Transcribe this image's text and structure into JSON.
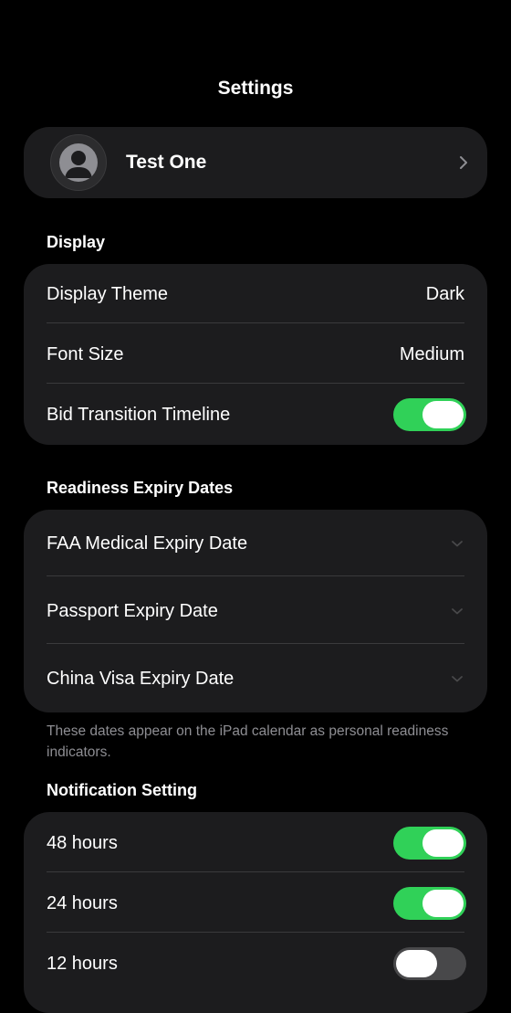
{
  "header": {
    "title": "Settings"
  },
  "profile": {
    "name": "Test One",
    "avatar_icon": "person-icon",
    "chevron_icon": "chevron-right-icon"
  },
  "display": {
    "header": "Display",
    "theme_label": "Display Theme",
    "theme_value": "Dark",
    "font_label": "Font Size",
    "font_value": "Medium",
    "bid_label": "Bid Transition Timeline",
    "bid_enabled": true
  },
  "readiness": {
    "header": "Readiness Expiry Dates",
    "items": [
      {
        "label": "FAA Medical Expiry Date"
      },
      {
        "label": "Passport Expiry Date"
      },
      {
        "label": "China Visa Expiry Date"
      }
    ],
    "footnote": "These dates appear on the iPad calendar as personal readiness indicators."
  },
  "notifications": {
    "header": "Notification Setting",
    "items": [
      {
        "label": "48 hours",
        "enabled": true
      },
      {
        "label": "24 hours",
        "enabled": true
      },
      {
        "label": "12 hours",
        "enabled": false
      }
    ]
  },
  "colors": {
    "background": "#000000",
    "card": "#1c1c1e",
    "toggle_on": "#30d158",
    "toggle_off": "#48484a",
    "secondary_text": "#8e8e93"
  }
}
